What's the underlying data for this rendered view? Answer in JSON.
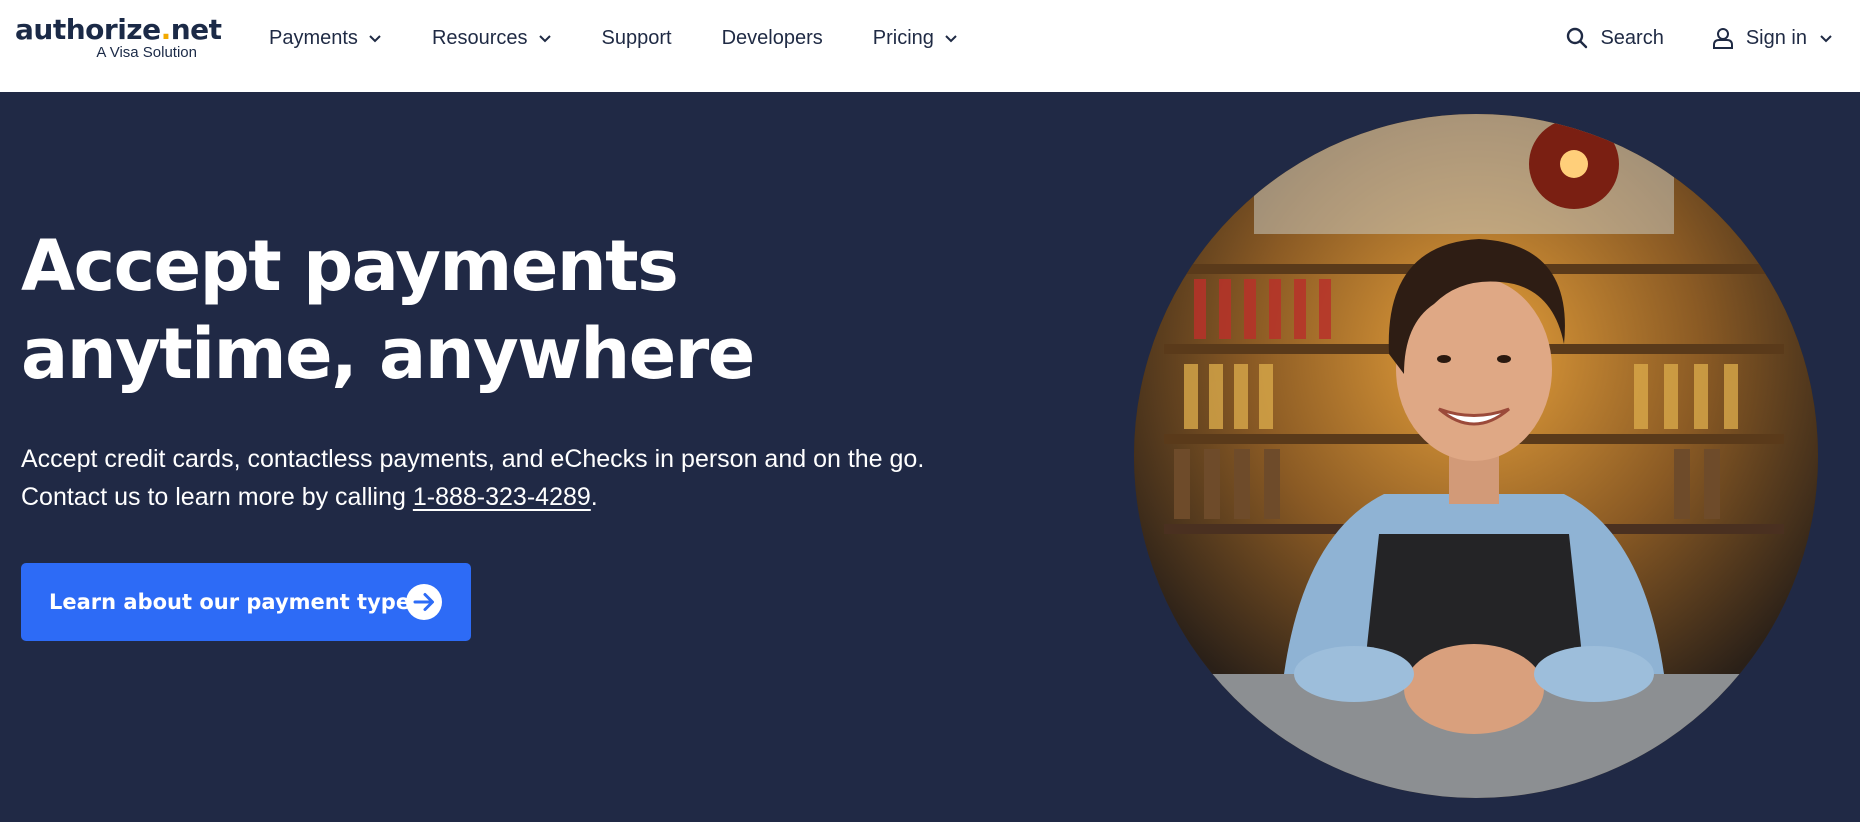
{
  "brand": {
    "name_part1": "authorize",
    "name_dot": ".",
    "name_part2": "net",
    "tagline": "A Visa Solution",
    "accent_color": "#f2a900"
  },
  "nav": {
    "items": [
      {
        "label": "Payments",
        "has_dropdown": true
      },
      {
        "label": "Resources",
        "has_dropdown": true
      },
      {
        "label": "Support",
        "has_dropdown": false
      },
      {
        "label": "Developers",
        "has_dropdown": false
      },
      {
        "label": "Pricing",
        "has_dropdown": true
      }
    ]
  },
  "utility": {
    "search_label": "Search",
    "search_icon": "search-icon",
    "signin_label": "Sign in",
    "signin_icon": "user-icon"
  },
  "hero": {
    "title": "Accept payments anytime, anywhere",
    "description_before": "Accept credit cards, contactless payments, and eChecks in person and on the go. Contact us to learn more by calling ",
    "phone": "1-888-323-4289",
    "description_after": ".",
    "cta_label": "Learn about our payment types",
    "cta_icon": "arrow-right-circle-icon",
    "background_color": "#202945",
    "cta_color": "#2d6bf6",
    "image_alt_subject": "smiling woman in apron leaning on a bar counter"
  }
}
